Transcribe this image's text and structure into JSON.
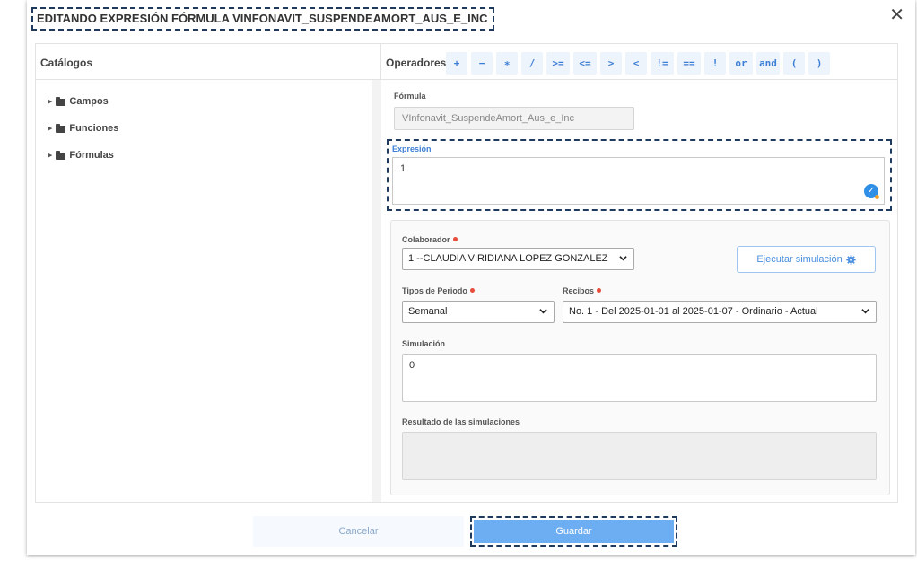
{
  "dialog": {
    "title": "EDITANDO EXPRESIÓN FÓRMULA VINFONAVIT_SUSPENDEAMORT_AUS_E_INC",
    "close_glyph": "✕"
  },
  "catalogs": {
    "header": "Catálogos",
    "items": [
      {
        "label": "Campos",
        "icon": "folder-icon"
      },
      {
        "label": "Funciones",
        "icon": "folder-icon"
      },
      {
        "label": "Fórmulas",
        "icon": "folder-icon"
      }
    ]
  },
  "operators": {
    "label": "Operadores",
    "items": [
      "+",
      "−",
      "∗",
      "/",
      ">=",
      "<=",
      ">",
      "<",
      "!=",
      "==",
      "!",
      "or",
      "and",
      "(",
      ")"
    ]
  },
  "formula": {
    "label": "Fórmula",
    "value": "VInfonavit_SuspendeAmort_Aus_e_Inc"
  },
  "expression": {
    "label": "Expresión",
    "value": "1",
    "status_icon": "check-circle-icon"
  },
  "simulation": {
    "colaborador_label": "Colaborador",
    "colaborador_value": "1 --CLAUDIA VIRIDIANA LOPEZ GONZALEZ",
    "run_button": "Ejecutar simulación",
    "tipos_label": "Tipos de Periodo",
    "tipos_value": "Semanal",
    "recibos_label": "Recibos",
    "recibos_value": "No. 1 - Del 2025-01-01 al 2025-01-07 - Ordinario - Actual",
    "sim_label": "Simulación",
    "sim_value": "0",
    "results_label": "Resultado de las simulaciones",
    "results_value": ""
  },
  "footer": {
    "cancel_label": "Cancelar",
    "save_label": "Guardar"
  },
  "colors": {
    "accent": "#3d7fd6",
    "primary_button": "#6daef2",
    "required": "#e74c3c",
    "highlight_border": "#1e3a5f"
  }
}
